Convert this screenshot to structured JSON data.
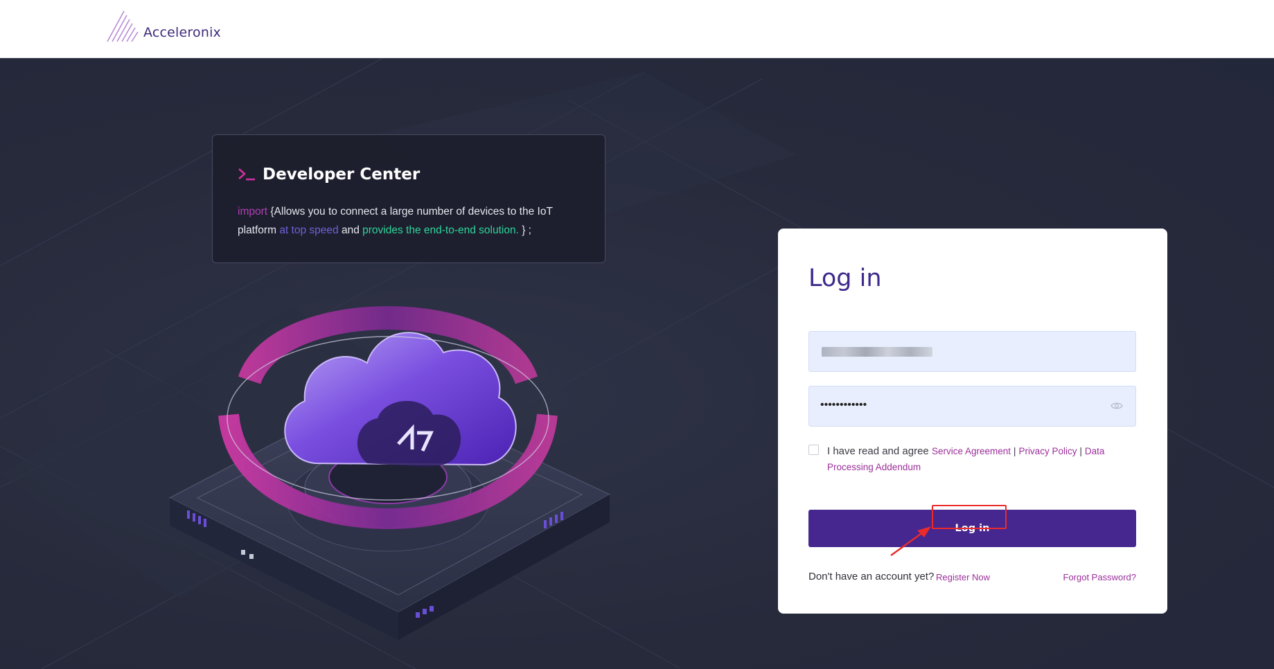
{
  "header": {
    "brand_name": "Acceleronix",
    "brand_color": "#3d2a7a"
  },
  "developer_center": {
    "title": "Developer Center",
    "prompt_icon": "terminal-prompt-icon",
    "code_keyword": "import",
    "code_open": " {Allows you to connect a large number of devices to the IoT platform ",
    "code_speed": "at top speed",
    "code_and": " and ",
    "code_solution": "provides the end-to-end solution.",
    "code_close": " } ;"
  },
  "login": {
    "title": "Log in",
    "password_value": "••••••••••••",
    "agree_prefix": "I have read and agree ",
    "service_agreement": "Service Agreement",
    "separator": " | ",
    "privacy_policy": "Privacy Policy",
    "data_processing": "Data Processing Addendum",
    "login_button": "Log in",
    "no_account_text": "Don't have an account yet?",
    "register_link": "Register Now",
    "forgot_link": "Forgot Password?",
    "accent_color": "#45278f",
    "link_color": "#9b2f9a"
  },
  "annotation": {
    "highlight_color": "#ec2a2a"
  }
}
